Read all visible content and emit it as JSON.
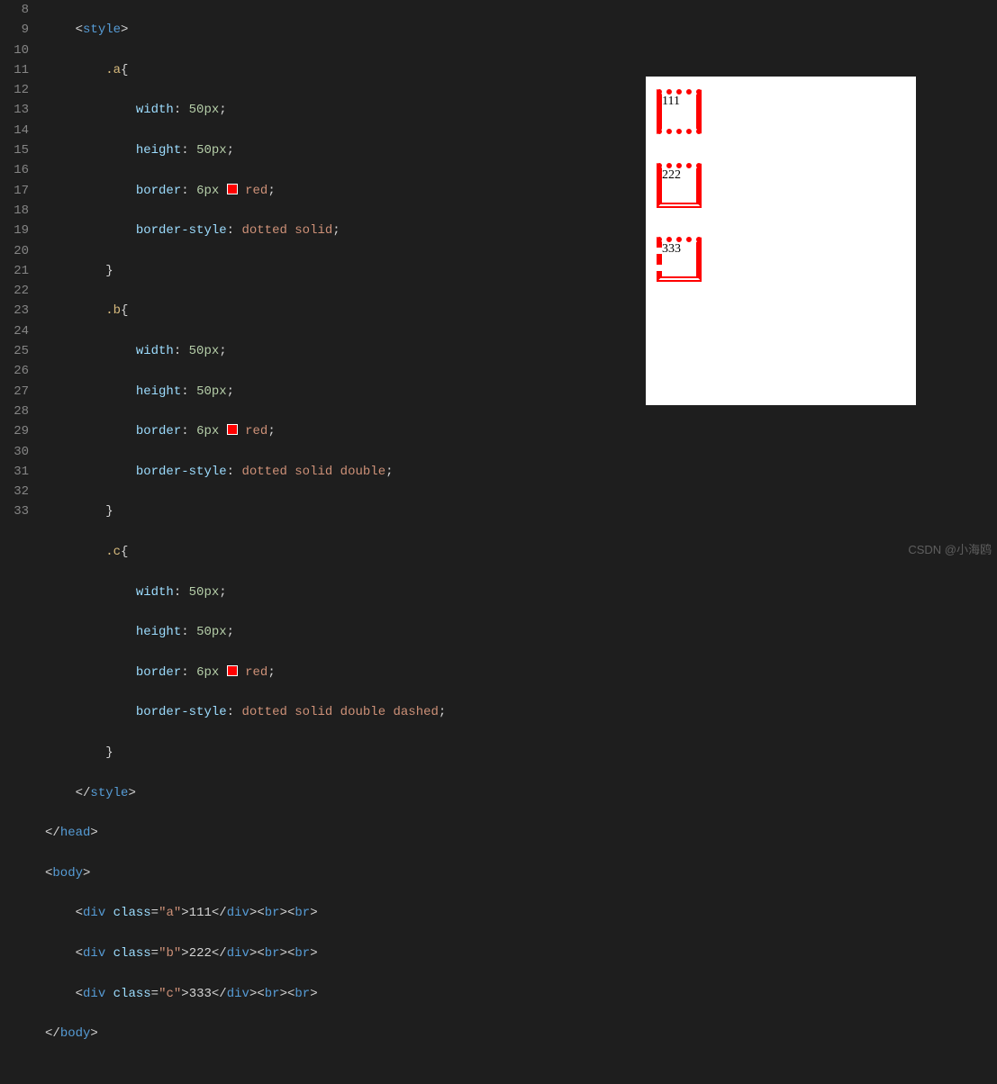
{
  "gutter": [
    "8",
    "9",
    "10",
    "11",
    "12",
    "13",
    "14",
    "15",
    "16",
    "17",
    "18",
    "19",
    "20",
    "21",
    "22",
    "23",
    "24",
    "25",
    "26",
    "27",
    "28",
    "29",
    "30",
    "31",
    "32",
    "33"
  ],
  "code": {
    "style_open": "style",
    "style_close": "style",
    "head_close": "head",
    "body_open": "body",
    "body_close": "body",
    "div": "div",
    "class_attr": "class",
    "br": "br",
    "sel_a": ".a",
    "sel_b": ".b",
    "sel_c": ".c",
    "p_width": "width",
    "p_height": "height",
    "p_border": "border",
    "p_border_style": "border-style",
    "v_50px": "50px",
    "v_6px": "6px",
    "v_red": "red",
    "v_ds": "dotted solid",
    "v_dsd": "dotted solid double",
    "v_dsdd": "dotted solid double dashed",
    "cls_a": "\"a\"",
    "cls_b": "\"b\"",
    "cls_c": "\"c\"",
    "txt_111": "111",
    "txt_222": "222",
    "txt_333": "333"
  },
  "preview": {
    "box_a": "111",
    "box_b": "222",
    "box_c": "333"
  },
  "watermark": "CSDN @小海鸥"
}
